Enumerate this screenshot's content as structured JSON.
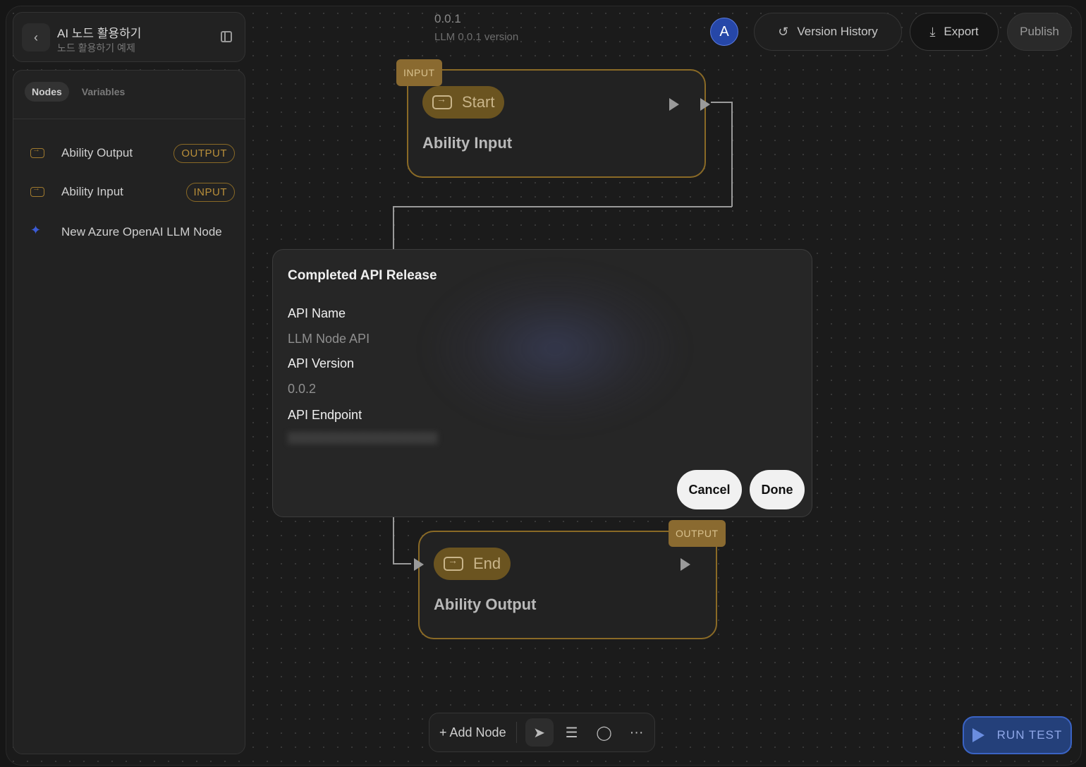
{
  "project": {
    "title": "AI 노드 활용하기",
    "subtitle": "노드 활용하기 예제"
  },
  "sidebar": {
    "tabs": [
      {
        "label": "Nodes",
        "active": true
      },
      {
        "label": "Variables",
        "active": false
      }
    ],
    "items": [
      {
        "label": "Ability Output",
        "badge": "OUTPUT",
        "icon": "enter-box-icon"
      },
      {
        "label": "Ability Input",
        "badge": "INPUT",
        "icon": "enter-box-icon"
      },
      {
        "label": "New Azure OpenAI LLM Node",
        "badge": "",
        "icon": "sparkle-icon"
      }
    ]
  },
  "version": {
    "number": "0.0.1",
    "description": "LLM 0.0.1 version"
  },
  "topbar": {
    "avatar_letter": "A",
    "version_history_label": "Version History",
    "export_label": "Export",
    "publish_label": "Publish"
  },
  "canvas": {
    "start_node": {
      "tag": "INPUT",
      "chip_label": "Start",
      "title": "Ability Input"
    },
    "end_node": {
      "tag": "OUTPUT",
      "chip_label": "End",
      "title": "Ability Output"
    }
  },
  "modal": {
    "title": "Completed API Release",
    "api_name_label": "API Name",
    "api_name_value": "LLM Node API",
    "api_version_label": "API Version",
    "api_version_value": "0.0.2",
    "api_endpoint_label": "API Endpoint",
    "cancel_label": "Cancel",
    "done_label": "Done"
  },
  "toolbar": {
    "add_node_label": "+ Add Node"
  },
  "run_test_label": "RUN TEST",
  "colors": {
    "accent_gold": "#8a6a26",
    "run_test_blue": "#24407a",
    "avatar_blue": "#2647a8"
  }
}
